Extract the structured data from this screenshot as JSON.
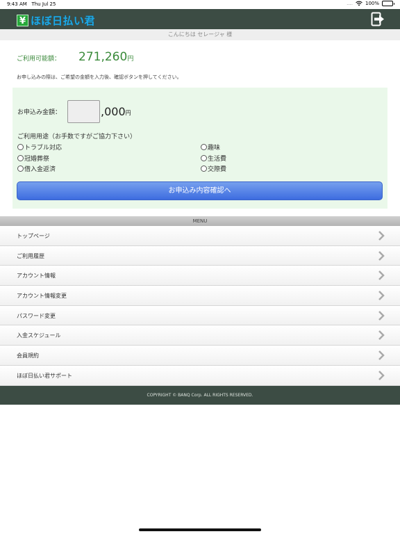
{
  "status_bar": {
    "time": "9:43 AM",
    "date": "Thu Jul 25",
    "signal": "....",
    "battery_percent": "100%"
  },
  "header": {
    "logo_mark": "¥",
    "logo_text": "ほぼ日払い君",
    "logout_icon": "logout-icon"
  },
  "greeting": "こんにちは セレージャ 様",
  "available": {
    "label": "ご利用可能額：",
    "amount": "271,260",
    "unit": "円"
  },
  "instruction": "お申し込みの際は、ご希望の金額を入力後、確認ボタンを押してください。",
  "form": {
    "amount_label": "お申込み金額：",
    "amount_value": "",
    "amount_suffix": ",000",
    "amount_unit": "円",
    "purpose_title": "ご利用用途（お手数ですがご協力下さい）",
    "purposes": [
      "トラブル対応",
      "趣味",
      "冠婚葬祭",
      "生活費",
      "借入金返済",
      "交際費"
    ],
    "confirm_label": "お申込み内容確認へ"
  },
  "menu": {
    "title": "MENU",
    "items": [
      "トップページ",
      "ご利用履歴",
      "アカウント情報",
      "アカウント情報変更",
      "パスワード変更",
      "入金スケジュール",
      "会員規約",
      "ほぼ日払い君サポート"
    ]
  },
  "footer": "COPYRIGHT © BANQ Corp. ALL RIGHTS RESERVED.",
  "colors": {
    "header_bg": "#3c4c44",
    "accent_green": "#3a8a3a",
    "button_blue": "#3d6ce0",
    "panel_bg": "#eaf8ea"
  }
}
